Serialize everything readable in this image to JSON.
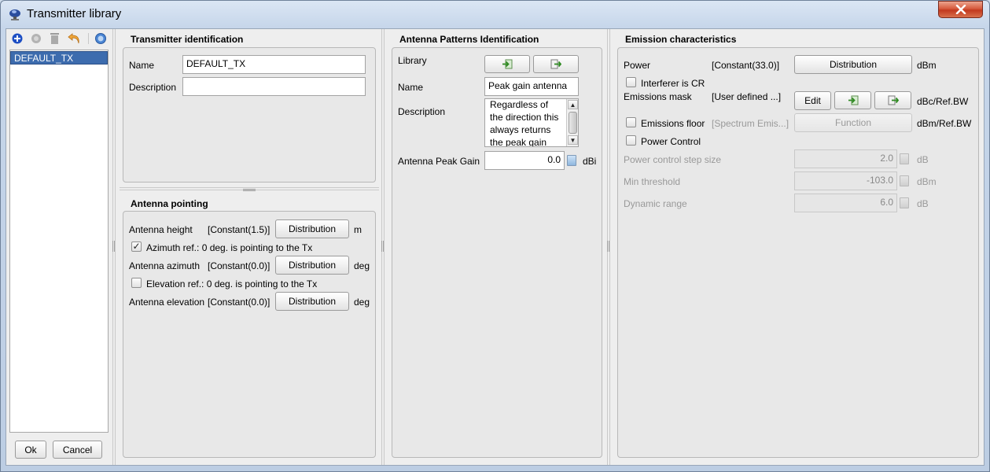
{
  "window": {
    "title": "Transmitter library",
    "icon": "satellite-dish-icon"
  },
  "left_panel": {
    "toolbar": [
      "add-icon",
      "record-icon",
      "delete-icon",
      "undo-icon",
      "help-icon"
    ],
    "items": [
      "DEFAULT_TX"
    ],
    "selected": "DEFAULT_TX",
    "ok_label": "Ok",
    "cancel_label": "Cancel"
  },
  "transmitter_id": {
    "title": "Transmitter identification",
    "name_label": "Name",
    "name_value": "DEFAULT_TX",
    "description_label": "Description",
    "description_value": ""
  },
  "antenna_pointing": {
    "title": "Antenna pointing",
    "height_label": "Antenna height",
    "height_value": "[Constant(1.5)]",
    "height_unit": "m",
    "azimuth_ref_label": "Azimuth ref.: 0 deg. is pointing to the Tx",
    "azimuth_ref_checked": true,
    "azimuth_label": "Antenna azimuth",
    "azimuth_value": "[Constant(0.0)]",
    "azimuth_unit": "deg",
    "elevation_ref_label": "Elevation ref.: 0 deg. is pointing to the Tx",
    "elevation_ref_checked": false,
    "elevation_label": "Antenna elevation",
    "elevation_value": "[Constant(0.0)]",
    "elevation_unit": "deg",
    "distribution_label": "Distribution"
  },
  "antenna_patterns": {
    "title": "Antenna Patterns Identification",
    "library_label": "Library",
    "import_icon": "import-icon",
    "export_icon": "export-icon",
    "name_label": "Name",
    "name_value": "Peak gain antenna",
    "description_label": "Description",
    "description_lines": [
      "Regardless of",
      "the direction this",
      "always returns",
      "the peak gain"
    ],
    "peak_gain_label": "Antenna Peak Gain",
    "peak_gain_value": "0.0",
    "peak_gain_unit": "dBi"
  },
  "emission": {
    "title": "Emission characteristics",
    "power_label": "Power",
    "power_value": "[Constant(33.0)]",
    "power_button": "Distribution",
    "power_unit": "dBm",
    "interferer_label": "Interferer is CR",
    "interferer_checked": false,
    "mask_label": "Emissions mask",
    "mask_value": "[User defined ...]",
    "mask_edit": "Edit",
    "mask_unit": "dBc/Ref.BW",
    "floor_label": "Emissions floor",
    "floor_value": "[Spectrum Emis...]",
    "floor_button": "Function",
    "floor_unit": "dBm/Ref.BW",
    "power_control_label": "Power Control",
    "power_control_checked": false,
    "step_label": "Power control step size",
    "step_value": "2.0",
    "step_unit": "dB",
    "min_label": "Min threshold",
    "min_value": "-103.0",
    "min_unit": "dBm",
    "range_label": "Dynamic range",
    "range_value": "6.0",
    "range_unit": "dB"
  },
  "colors": {
    "selection": "#3d6cae",
    "window_frame": "#cfdcec",
    "close_button": "#c2391e"
  }
}
